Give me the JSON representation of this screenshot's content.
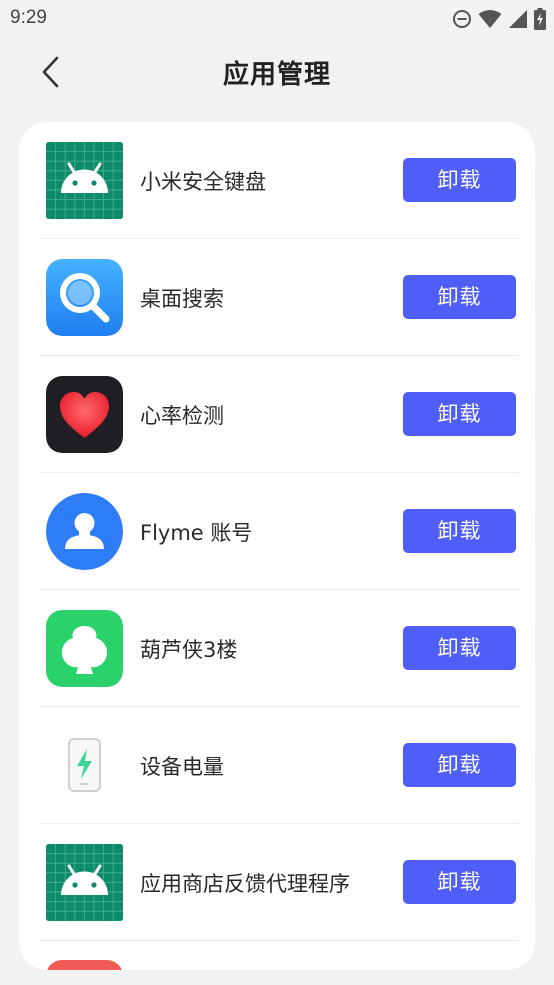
{
  "status_bar": {
    "time": "9:29",
    "icons": [
      "do-not-disturb-icon",
      "wifi-icon",
      "cellular-signal-icon",
      "battery-charging-icon"
    ]
  },
  "header": {
    "title": "应用管理",
    "back_icon": "back-arrow-icon"
  },
  "apps": [
    {
      "name": "小米安全键盘",
      "button": "卸载",
      "icon": "android-icon",
      "color": "#0d8a6a"
    },
    {
      "name": "桌面搜索",
      "button": "卸载",
      "icon": "search-app-icon",
      "color": "#2d8cf0"
    },
    {
      "name": "心率检测",
      "button": "卸载",
      "icon": "heart-rate-icon",
      "color": "#1f1f24"
    },
    {
      "name": "Flyme 账号",
      "button": "卸载",
      "icon": "flyme-account-icon",
      "color": "#2e7cf6"
    },
    {
      "name": "葫芦侠3楼",
      "button": "卸载",
      "icon": "huluxia-icon",
      "color": "#2bd26b"
    },
    {
      "name": "设备电量",
      "button": "卸载",
      "icon": "battery-app-icon",
      "color": "#3ed598"
    },
    {
      "name": "应用商店反馈代理程序",
      "button": "卸载",
      "icon": "android-icon",
      "color": "#0d8a6a"
    }
  ],
  "colors": {
    "button": "#4f5ef7",
    "background": "#f2f2f2",
    "card": "#ffffff"
  }
}
